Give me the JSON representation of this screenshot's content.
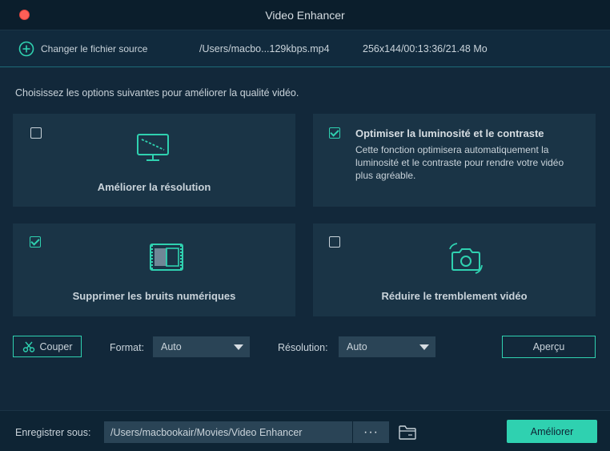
{
  "window": {
    "title": "Video Enhancer"
  },
  "source": {
    "change_label": "Changer le fichier source",
    "path": "/Users/macbo...129kbps.mp4",
    "info": "256x144/00:13:36/21.48 Mo"
  },
  "instruction": "Choisissez les options suivantes pour améliorer la qualité vidéo.",
  "options": {
    "resolution": {
      "label": "Améliorer la résolution",
      "checked": false,
      "icon": "monitor-icon"
    },
    "brightness": {
      "label": "Optimiser la luminosité et le contraste",
      "checked": true,
      "description": "Cette fonction optimisera automatiquement la luminosité et le contraste pour rendre votre vidéo plus agréable."
    },
    "noise": {
      "label": "Supprimer les bruits numériques",
      "checked": true,
      "icon": "film-icon"
    },
    "shake": {
      "label": "Réduire le tremblement vidéo",
      "checked": false,
      "icon": "camera-icon"
    }
  },
  "controls": {
    "cut_label": "Couper",
    "format_label": "Format:",
    "format_value": "Auto",
    "resolution_label": "Résolution:",
    "resolution_value": "Auto",
    "preview_label": "Aperçu"
  },
  "footer": {
    "save_label": "Enregistrer sous:",
    "save_path": "/Users/macbookair/Movies/Video Enhancer",
    "browse_label": "···",
    "enhance_label": "Améliorer"
  },
  "colors": {
    "accent": "#2fd1b0",
    "background": "#12283a",
    "card": "#1a3446"
  }
}
